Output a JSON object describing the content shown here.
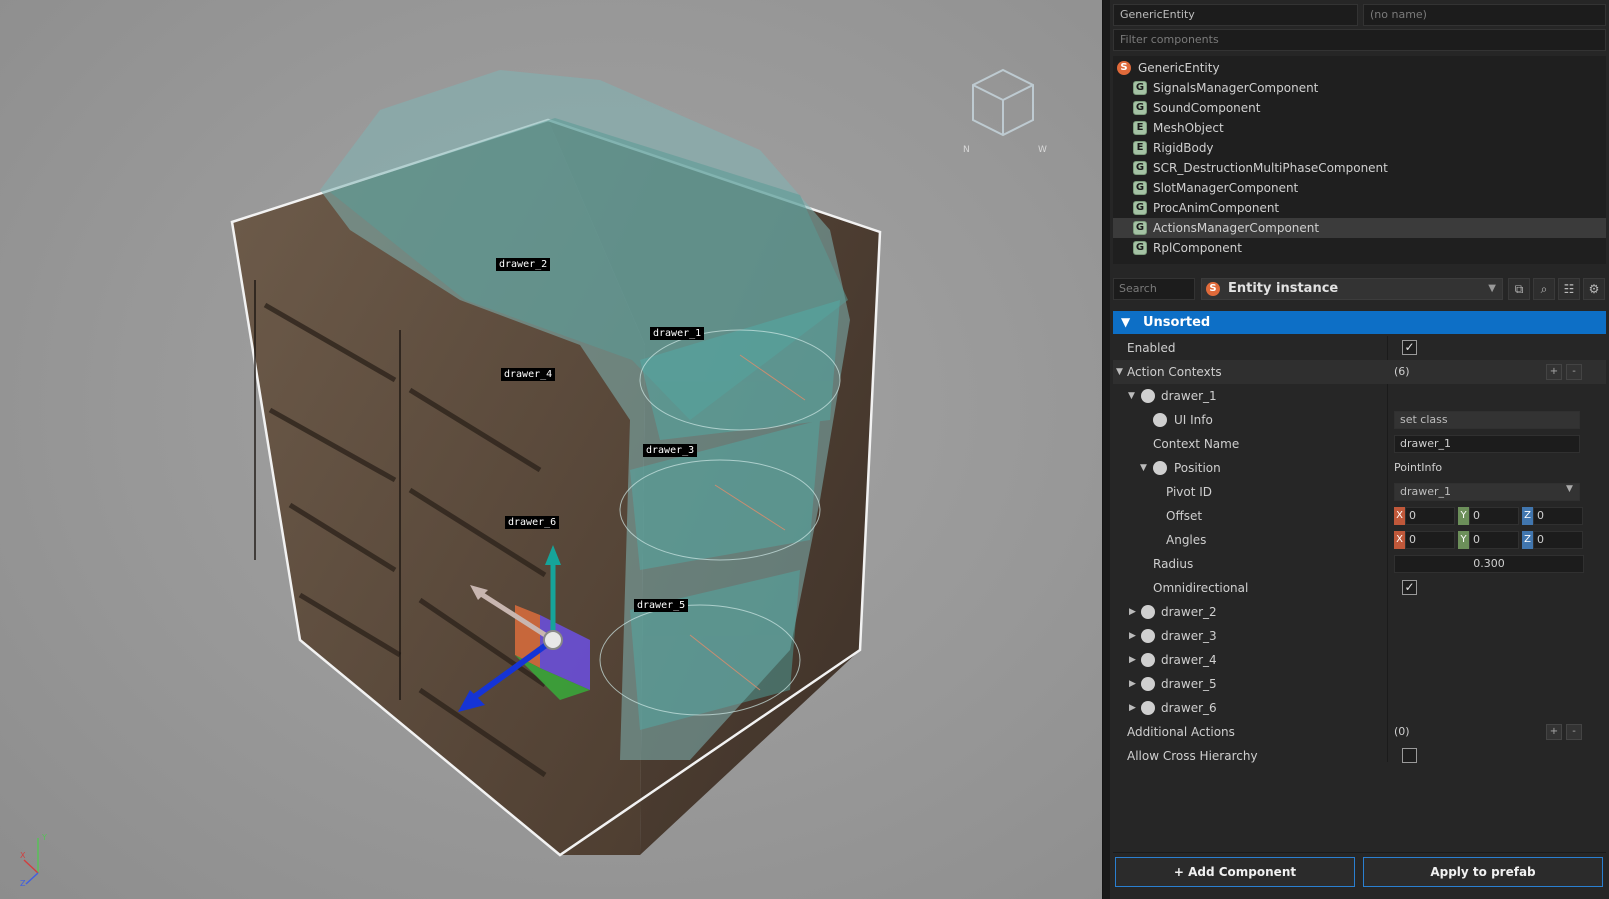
{
  "viewport": {
    "object_labels": [
      "drawer_2",
      "drawer_1",
      "drawer_4",
      "drawer_3",
      "drawer_6",
      "drawer_5"
    ],
    "colors": {
      "background": "#989898",
      "collision_hull": "#7fb4b4",
      "gizmo_x": "#c8452d",
      "gizmo_y": "#16a49a",
      "gizmo_z": "#1534d6"
    }
  },
  "entity_header": {
    "class_name": "GenericEntity",
    "name_placeholder": "(no name)",
    "filter_placeholder": "Filter components"
  },
  "components": [
    {
      "badge": "S",
      "name": "GenericEntity",
      "selected": false
    },
    {
      "badge": "G",
      "name": "SignalsManagerComponent",
      "selected": false
    },
    {
      "badge": "G",
      "name": "SoundComponent",
      "selected": false
    },
    {
      "badge": "E",
      "name": "MeshObject",
      "selected": false
    },
    {
      "badge": "E",
      "name": "RigidBody",
      "selected": false
    },
    {
      "badge": "G",
      "name": "SCR_DestructionMultiPhaseComponent",
      "selected": false
    },
    {
      "badge": "G",
      "name": "SlotManagerComponent",
      "selected": false
    },
    {
      "badge": "G",
      "name": "ProcAnimComponent",
      "selected": false
    },
    {
      "badge": "G",
      "name": "ActionsManagerComponent",
      "selected": true
    },
    {
      "badge": "G",
      "name": "RplComponent",
      "selected": false
    }
  ],
  "toolbar": {
    "search_placeholder": "Search",
    "entity_badge": "S",
    "entity_mode": "Entity instance",
    "icons": [
      "open-external-icon",
      "search-icon",
      "hierarchy-icon",
      "gear-icon"
    ]
  },
  "section": {
    "title": "Unsorted"
  },
  "props": {
    "enabled": {
      "label": "Enabled"
    },
    "action_contexts": {
      "label": "Action Contexts",
      "value": "(6)",
      "add": "+",
      "remove": "-"
    },
    "drawer_1": {
      "label": "drawer_1"
    },
    "ui_info": {
      "label": "UI Info",
      "value": "set class"
    },
    "context_name": {
      "label": "Context Name",
      "value": "drawer_1"
    },
    "position": {
      "label": "Position",
      "value": "PointInfo"
    },
    "pivot_id": {
      "label": "Pivot ID",
      "value": "drawer_1"
    },
    "offset": {
      "label": "Offset",
      "x": "0",
      "y": "0",
      "z": "0"
    },
    "angles": {
      "label": "Angles",
      "x": "0",
      "y": "0",
      "z": "0"
    },
    "radius": {
      "label": "Radius",
      "value": "0.300"
    },
    "omnidirectional": {
      "label": "Omnidirectional"
    },
    "drawers": [
      "drawer_2",
      "drawer_3",
      "drawer_4",
      "drawer_5",
      "drawer_6"
    ],
    "additional_actions": {
      "label": "Additional Actions",
      "value": "(0)",
      "add": "+",
      "remove": "-"
    },
    "allow_cross_hierarchy": {
      "label": "Allow Cross Hierarchy"
    },
    "axis_letters": {
      "x": "X",
      "y": "Y",
      "z": "Z"
    }
  },
  "buttons": {
    "add_component": "+ Add Component",
    "apply_prefab": "Apply to prefab"
  }
}
